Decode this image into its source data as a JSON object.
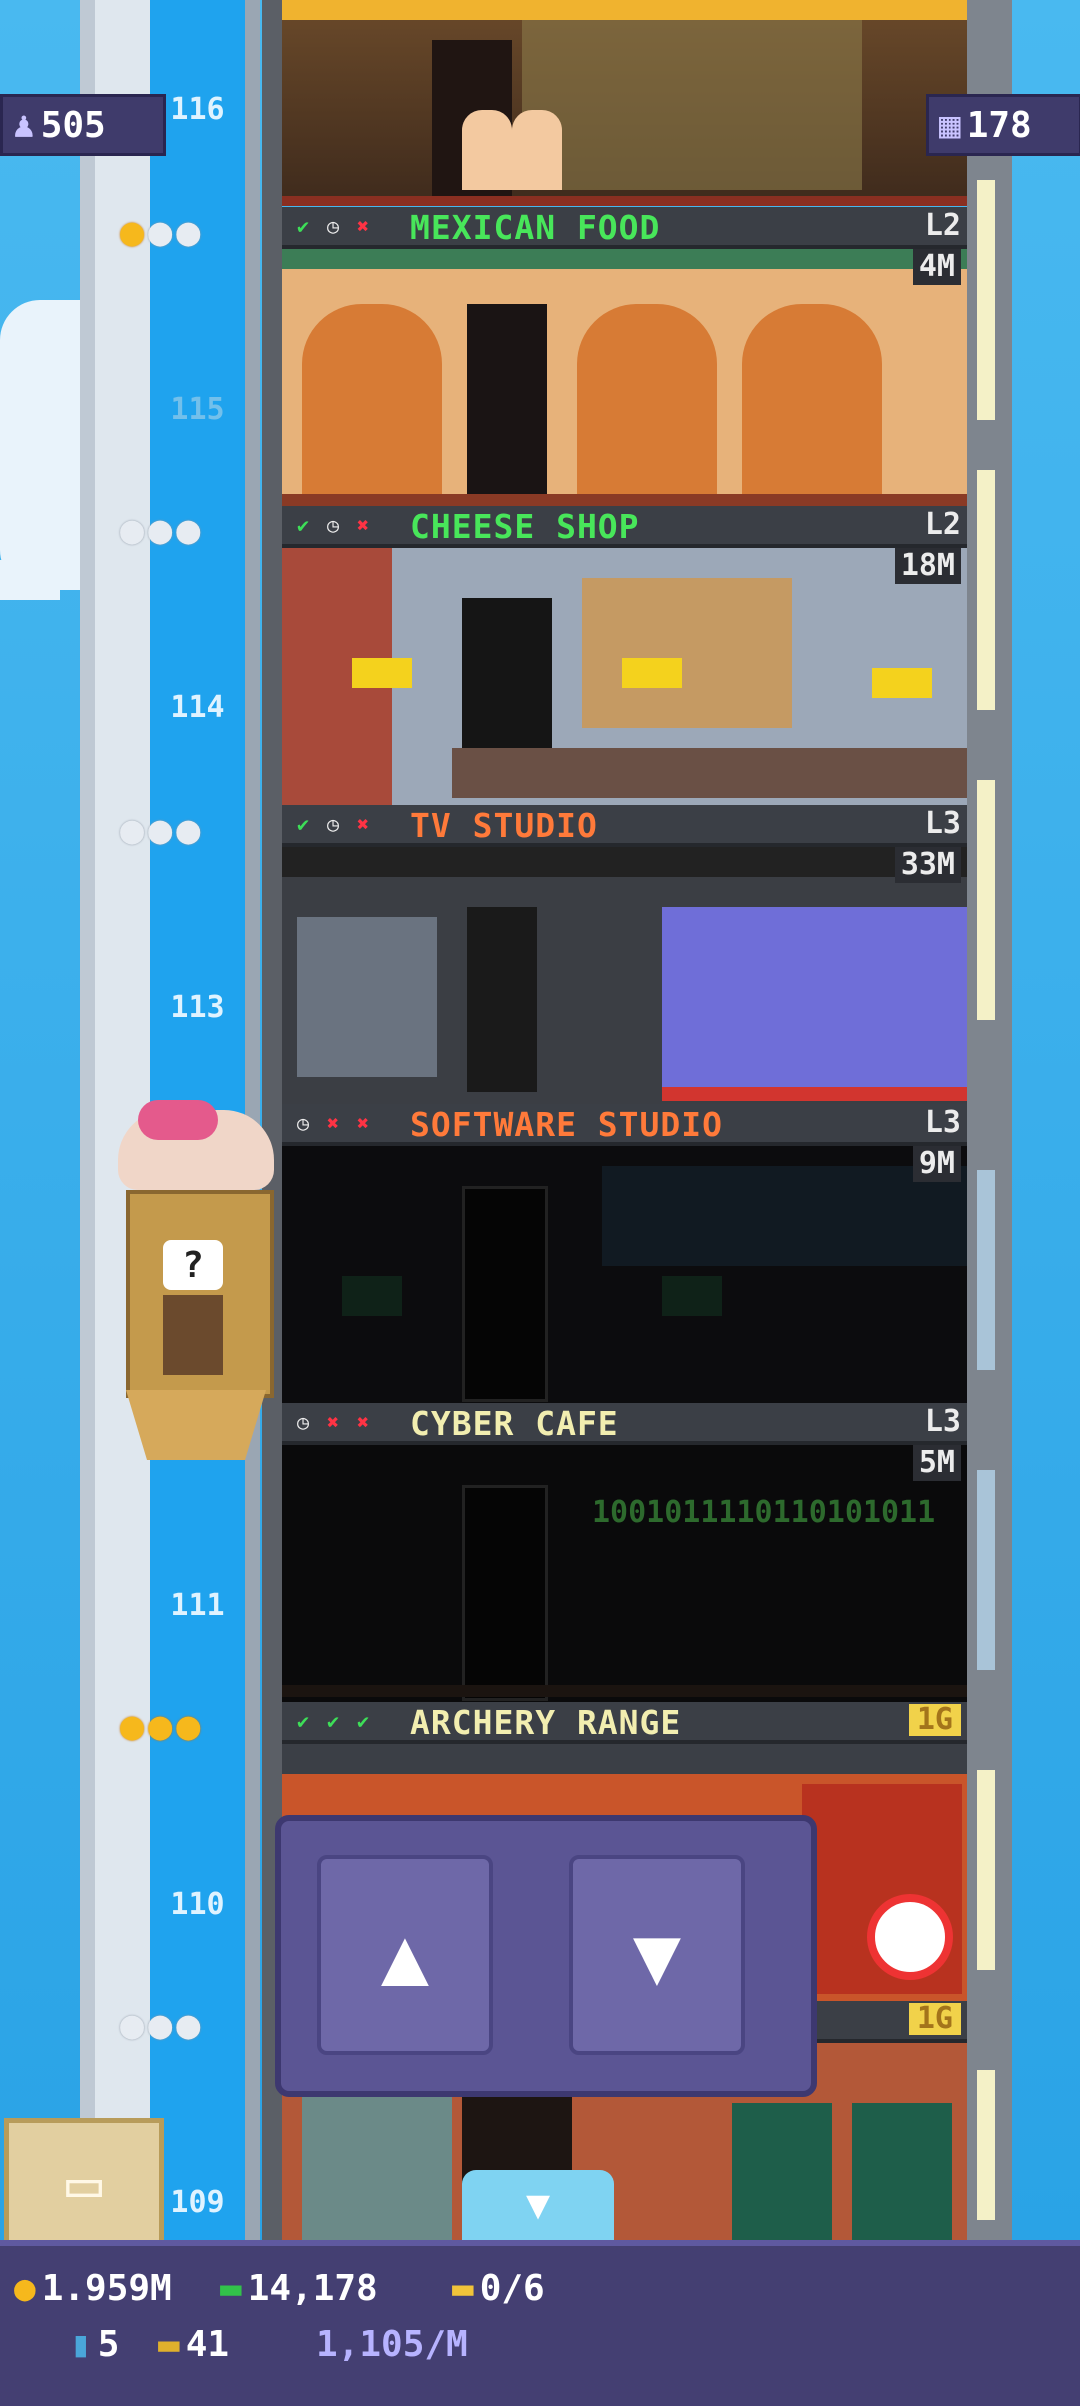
{
  "top": {
    "population": "505",
    "population_icon": "person-icon",
    "floors_count": "178",
    "floors_icon": "building-icon"
  },
  "floor_numbers": {
    "f116": "116",
    "f115": "115",
    "f114": "114",
    "f113": "113",
    "f111": "111",
    "f110": "110",
    "f109": "109"
  },
  "floors": [
    {
      "name": "MEXICAN FOOD",
      "level": "L2",
      "worth": "4M",
      "name_color": "#48e65a",
      "stars": "gold-1"
    },
    {
      "name": "CHEESE SHOP",
      "level": "L2",
      "worth": "18M",
      "name_color": "#48e65a"
    },
    {
      "name": "TV STUDIO",
      "level": "L3",
      "worth": "33M",
      "name_color": "#ff7a3a"
    },
    {
      "name": "SOFTWARE STUDIO",
      "level": "L3",
      "worth": "9M",
      "name_color": "#ff7a3a"
    },
    {
      "name": "CYBER CAFE",
      "level": "L3",
      "worth": "5M",
      "name_color": "#f2eeb0"
    },
    {
      "name": "ARCHERY RANGE",
      "level": "1G",
      "name_color": "#f2eeb0"
    },
    {
      "name": "",
      "level": "1G"
    }
  ],
  "cyber_binary": "1001011110110101011",
  "elevator": {
    "question": "?"
  },
  "nav": {
    "up": "▲",
    "down": "▼"
  },
  "bottom": {
    "coins": "1.959M",
    "bux": "14,178",
    "tickets": "0/6",
    "keys": "5",
    "vip": "41",
    "rate": "1,105/M"
  }
}
